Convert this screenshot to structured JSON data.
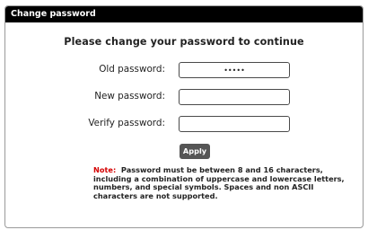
{
  "dialog": {
    "title": "Change password",
    "heading": "Please change your password to continue",
    "fields": {
      "old": {
        "label": "Old password:",
        "value": "•••••"
      },
      "new": {
        "label": "New password:",
        "value": ""
      },
      "verify": {
        "label": "Verify password:",
        "value": ""
      }
    },
    "apply_label": "Apply",
    "note": {
      "label": "Note:",
      "text": "  Password must be between 8 and 16 characters, including a combination of uppercase and lowercase letters, numbers, and special symbols. Spaces and non ASCII characters are not supported."
    },
    "colors": {
      "titlebar": "#000000",
      "button": "#555555",
      "note_label": "#d40000"
    }
  }
}
